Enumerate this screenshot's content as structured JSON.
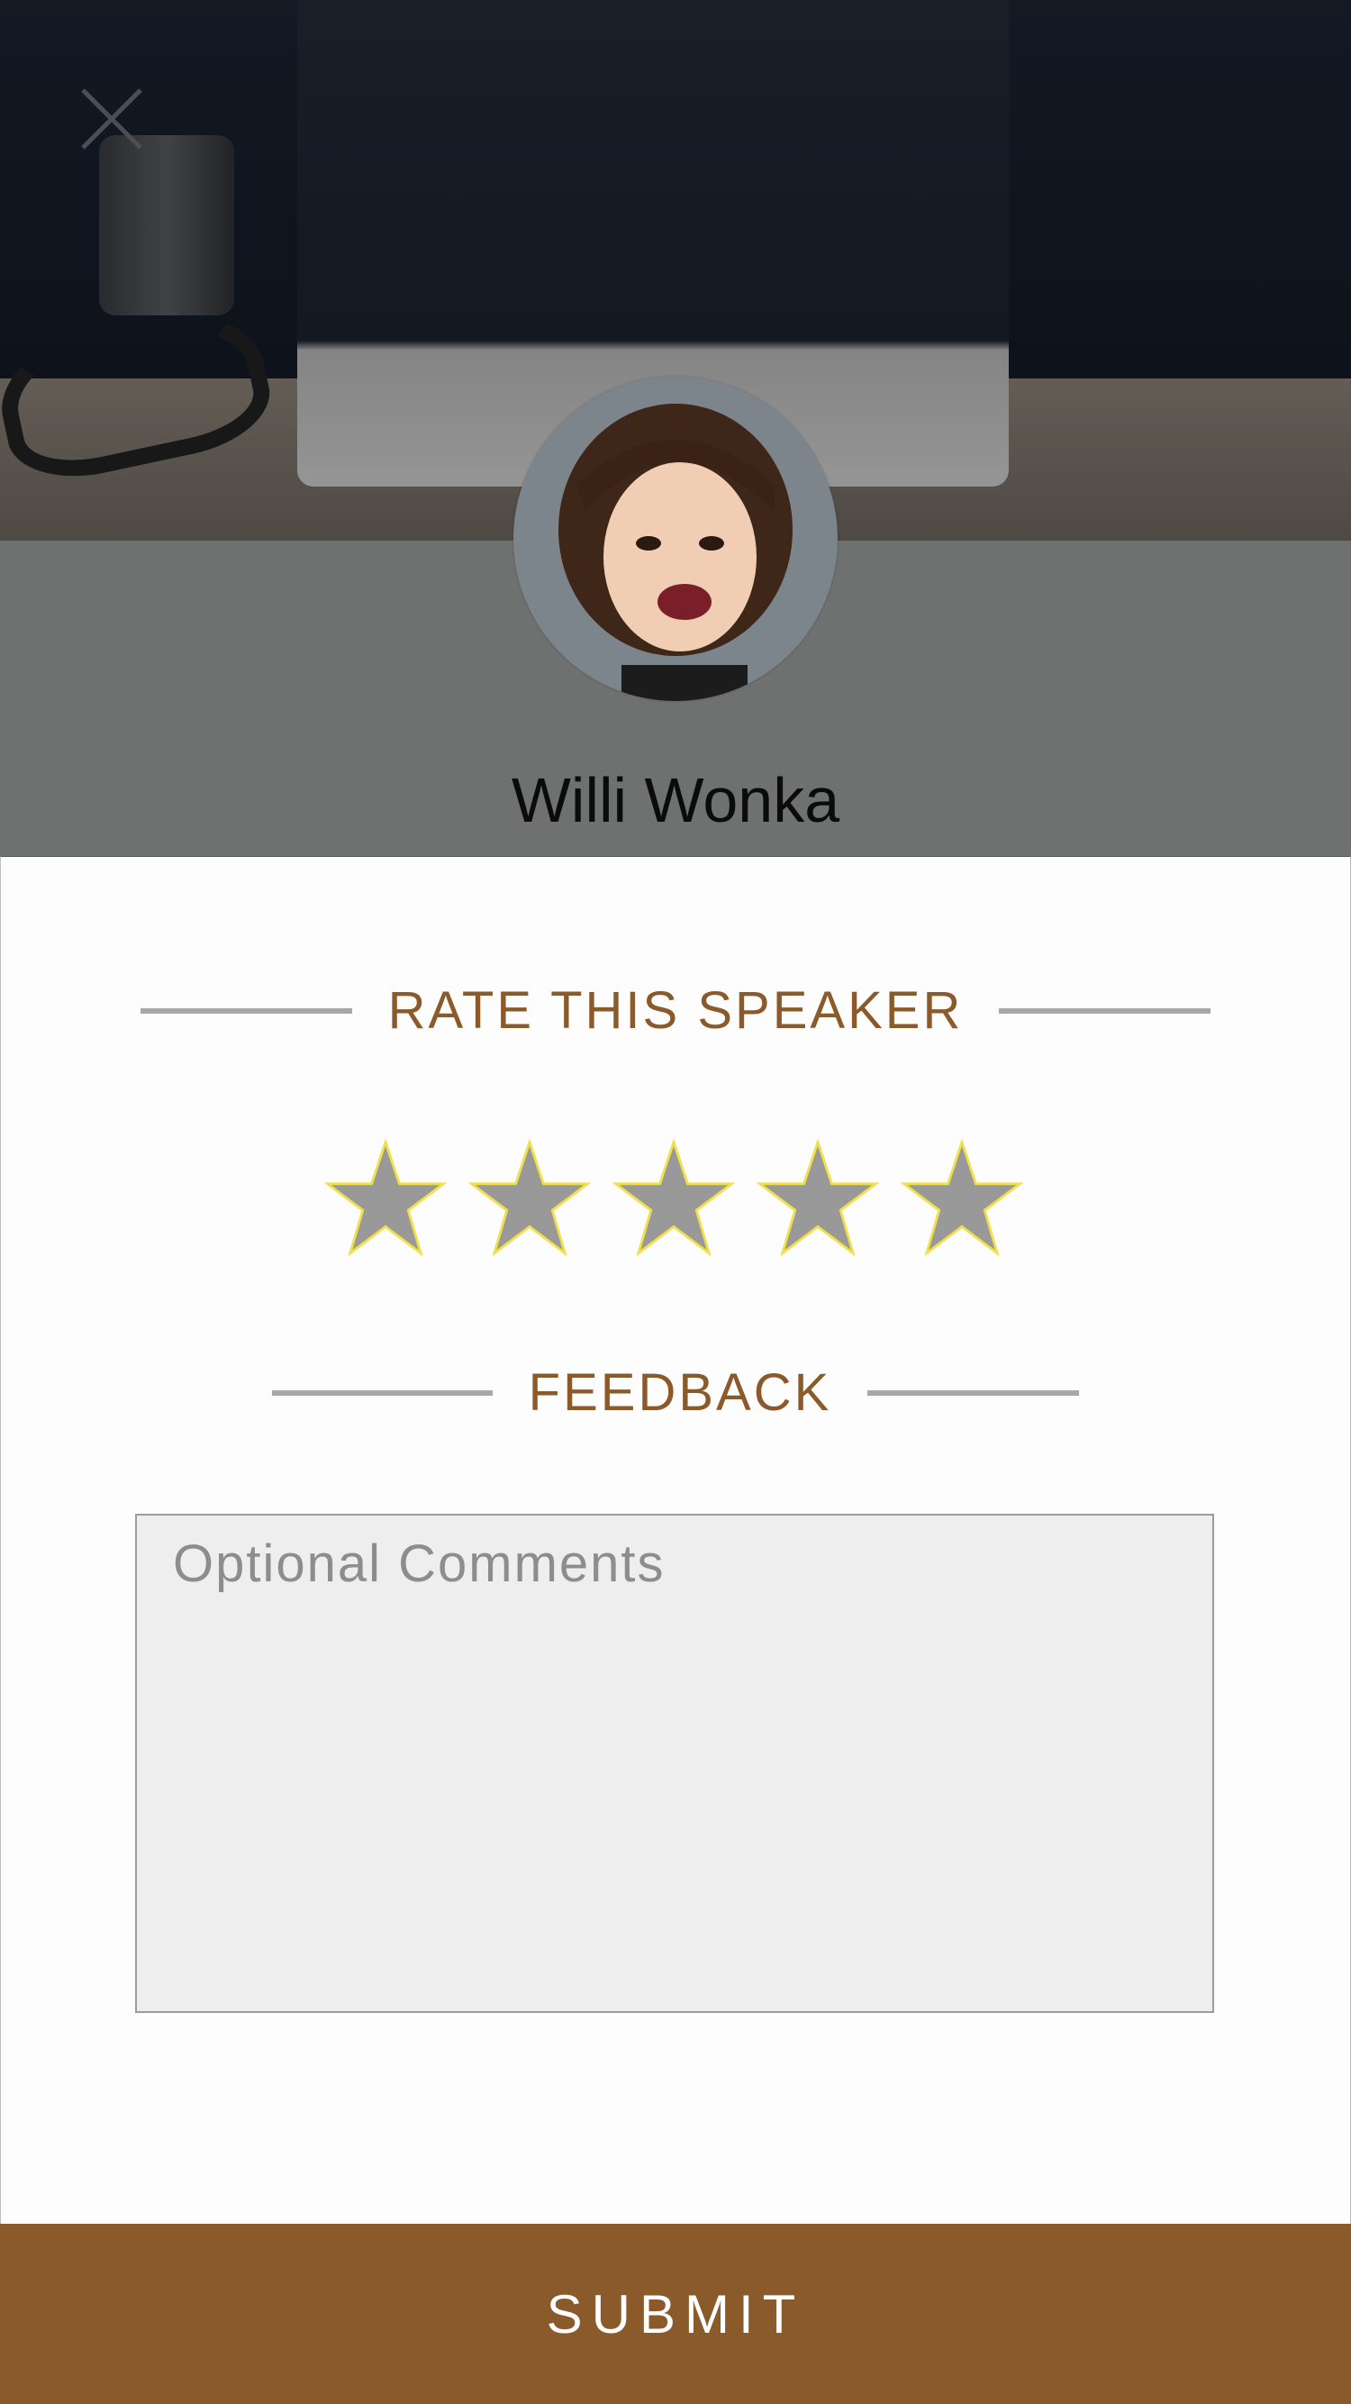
{
  "profile": {
    "name": "Willi Wonka"
  },
  "rating": {
    "title": "RATE THIS SPEAKER",
    "max_stars": 5,
    "selected_stars": 0,
    "star_fill_color": "#999999",
    "star_outline_color": "#f2e04a"
  },
  "feedback": {
    "title": "FEEDBACK",
    "comments_placeholder": "Optional Comments",
    "comments_value": ""
  },
  "actions": {
    "submit_label": "SUBMIT"
  },
  "colors": {
    "accent": "#8b5a2b",
    "divider": "#a7a7a7"
  }
}
